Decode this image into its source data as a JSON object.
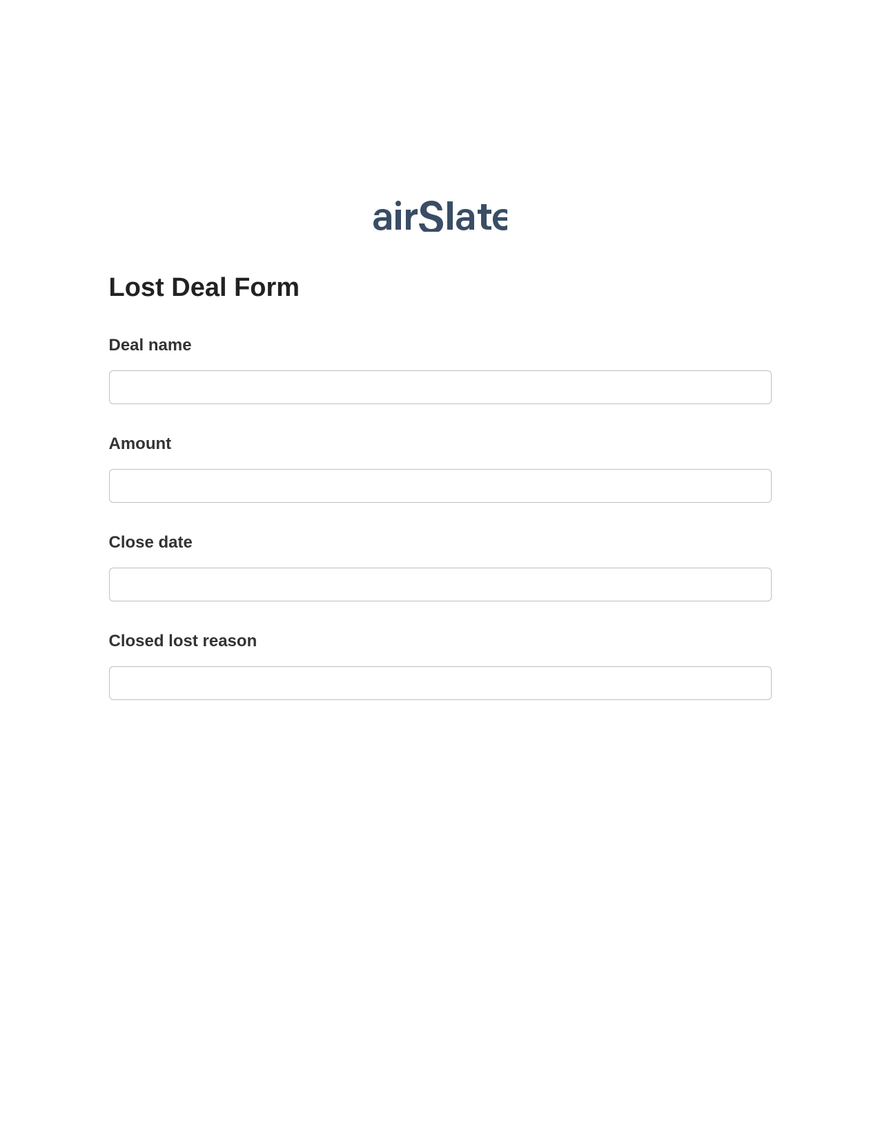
{
  "logo": {
    "text": "airSlate",
    "color": "#3a4d66"
  },
  "form": {
    "title": "Lost Deal Form",
    "fields": [
      {
        "label": "Deal name",
        "value": ""
      },
      {
        "label": "Amount",
        "value": ""
      },
      {
        "label": "Close date",
        "value": ""
      },
      {
        "label": "Closed lost reason",
        "value": ""
      }
    ]
  }
}
